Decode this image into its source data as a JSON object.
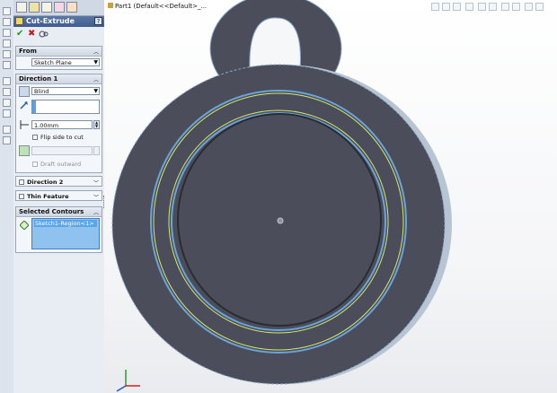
{
  "window": {
    "tree_label": "Part1 (Default<<Default>_..."
  },
  "property_manager": {
    "title": "Cut-Extrude",
    "help_label": "?",
    "ok_label": "✔",
    "cancel_label": "✖",
    "from": {
      "header": "From",
      "start_condition": "Sketch Plane"
    },
    "direction1": {
      "header": "Direction 1",
      "end_condition": "Blind",
      "depth": "1.00mm",
      "flip_side_to_cut": "Flip side to cut",
      "draft_outward": "Draft outward"
    },
    "direction2": {
      "header": "Direction 2"
    },
    "thin_feature": {
      "header": "Thin Feature"
    },
    "selected_contours": {
      "header": "Selected Contours",
      "items": [
        "Sketch1-Region<1>"
      ]
    }
  },
  "colors": {
    "part_face": "#4b4e5a",
    "part_edge": "#8aa7c6",
    "selected_contour": "#d8e86a",
    "titlebar": "#4a6a9c"
  },
  "icons": [
    "feature-manager-icon",
    "property-manager-icon",
    "configuration-manager-icon",
    "dimxpert-icon",
    "display-manager-icon",
    "cut-extrude-icon",
    "ok-check-icon",
    "cancel-x-icon",
    "detailed-preview-icon",
    "reverse-direction-icon",
    "direction-vector-icon",
    "depth-icon",
    "draft-icon",
    "contour-icon",
    "triad-icon"
  ]
}
